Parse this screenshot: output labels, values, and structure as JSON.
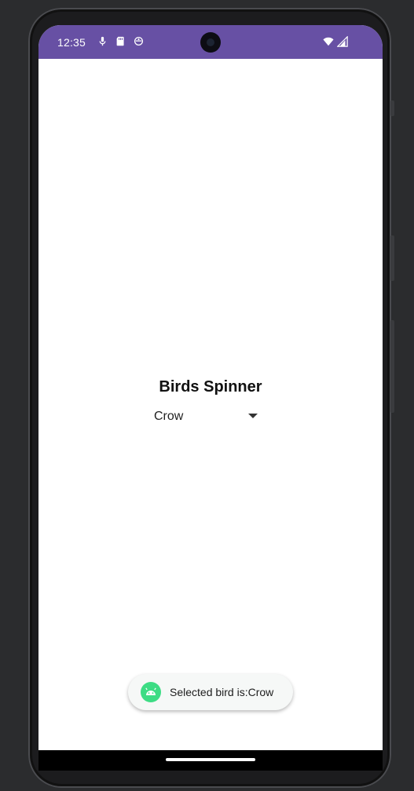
{
  "status_bar": {
    "time": "12:35",
    "left_icons": [
      "mic-icon",
      "sd-card-icon",
      "face-icon"
    ],
    "right_icons": [
      "wifi-icon",
      "signal-icon"
    ],
    "color": "#6750a4"
  },
  "app": {
    "title": "Birds Spinner",
    "spinner": {
      "selected": "Crow"
    }
  },
  "toast": {
    "text": "Selected bird is:Crow",
    "icon": "android-icon",
    "icon_color": "#3ddc84"
  }
}
